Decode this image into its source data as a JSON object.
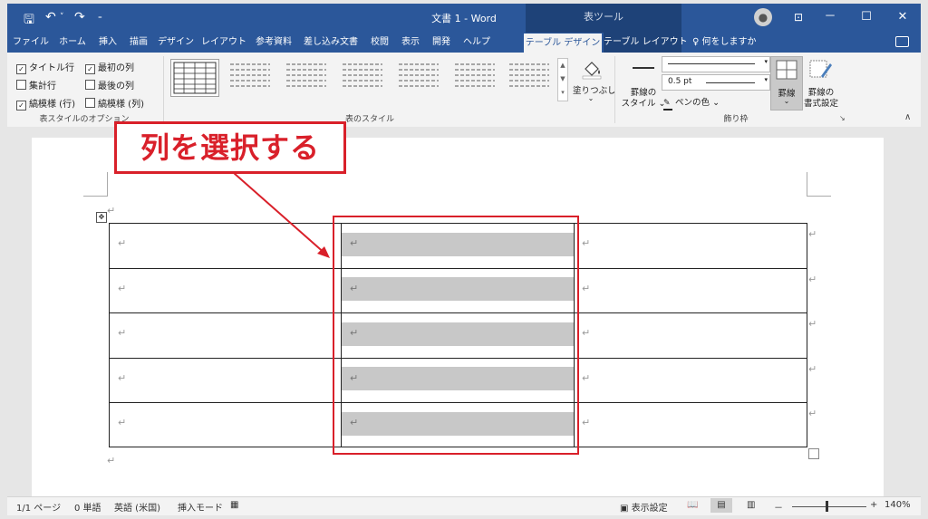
{
  "titlebar": {
    "title": "文書 1 - Word",
    "context_tab_header": "表ツール",
    "save_icon": "save-icon",
    "undo_icon": "undo-icon",
    "redo_icon": "redo-icon",
    "avatar_icon": "user-avatar-icon",
    "ribbon_display_icon": "ribbon-display-options-icon",
    "minimize": "－",
    "maximize": "☐",
    "close": "✕"
  },
  "tabs": [
    {
      "label": "ファイル"
    },
    {
      "label": "ホーム"
    },
    {
      "label": "挿入"
    },
    {
      "label": "描画"
    },
    {
      "label": "デザイン"
    },
    {
      "label": "レイアウト"
    },
    {
      "label": "参考資料"
    },
    {
      "label": "差し込み文書"
    },
    {
      "label": "校閲"
    },
    {
      "label": "表示"
    },
    {
      "label": "開発"
    },
    {
      "label": "ヘルプ"
    },
    {
      "label": "テーブル デザイン",
      "active": true
    },
    {
      "label": "テーブル レイアウト"
    }
  ],
  "tellme": "何をしますか",
  "ribbon": {
    "style_options": {
      "group_label": "表スタイルのオプション",
      "items": [
        {
          "label": "タイトル行",
          "checked": true
        },
        {
          "label": "最初の列",
          "checked": true
        },
        {
          "label": "集計行",
          "checked": false
        },
        {
          "label": "最後の列",
          "checked": false
        },
        {
          "label": "縞模様 (行)",
          "checked": true
        },
        {
          "label": "縞模様 (列)",
          "checked": false
        }
      ]
    },
    "table_styles": {
      "group_label": "表のスタイル",
      "shading_label": "塗りつぶし"
    },
    "borders": {
      "group_label": "飾り枠",
      "border_style_label_1": "罫線の",
      "border_style_label_2": "スタイル",
      "pen_weight": "0.5 pt",
      "pen_color_label": "ペンの色",
      "borders_label": "罫線",
      "painter_label_1": "罫線の",
      "painter_label_2": "書式設定"
    }
  },
  "document": {
    "callout_text": "列を選択する",
    "paragraph_mark": "↵",
    "cell_mark": "↵"
  },
  "status": {
    "page": "1/1 ページ",
    "words": "0 単語",
    "language": "英語 (米国)",
    "mode": "挿入モード",
    "display_settings": "表示設定",
    "zoom": "140%",
    "zoom_minus": "－",
    "zoom_plus": "+"
  },
  "colors": {
    "accent": "#2b579a",
    "context_tab": "#1e4278",
    "highlight_red": "#d9202a",
    "selection": "#c8c8c8"
  }
}
